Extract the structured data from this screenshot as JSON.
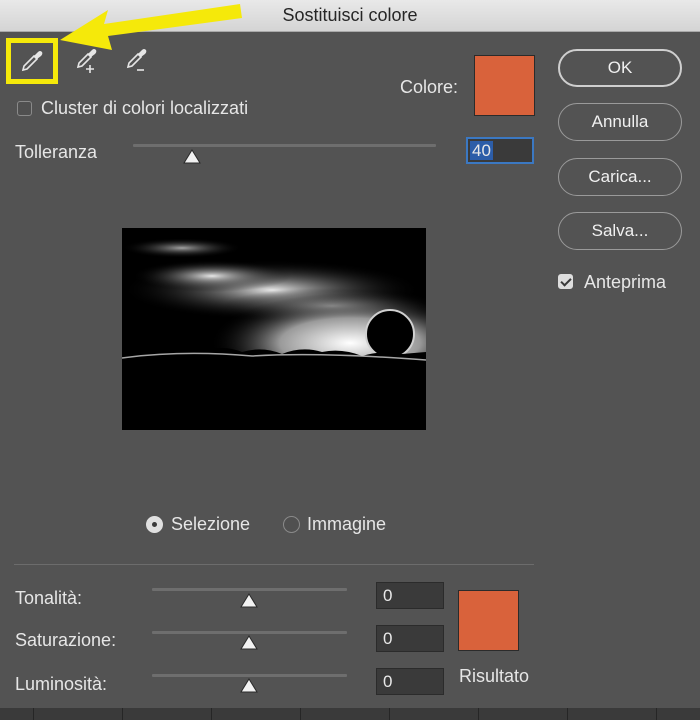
{
  "window": {
    "title": "Sostituisci colore"
  },
  "tools": [
    {
      "name": "eyedropper",
      "selected": true
    },
    {
      "name": "eyedropper-plus"
    },
    {
      "name": "eyedropper-minus"
    }
  ],
  "color": {
    "label": "Colore:",
    "hex": "#d9623b"
  },
  "cluster": {
    "label": "Cluster di colori localizzati",
    "checked": false
  },
  "tolerance": {
    "label": "Tolleranza",
    "value": "40",
    "fraction": 0.2
  },
  "view": {
    "options": [
      {
        "label": "Selezione",
        "selected": true
      },
      {
        "label": "Immagine",
        "selected": false
      }
    ]
  },
  "adjust": {
    "hue": {
      "label": "Tonalità:",
      "value": "0"
    },
    "saturation": {
      "label": "Saturazione:",
      "value": "0"
    },
    "lightness": {
      "label": "Luminosità:",
      "value": "0"
    }
  },
  "result": {
    "label": "Risultato",
    "hex": "#d9623b"
  },
  "buttons": {
    "ok": "OK",
    "cancel": "Annulla",
    "load": "Carica...",
    "save": "Salva..."
  },
  "preview_checkbox": {
    "label": "Anteprima",
    "checked": true
  },
  "colors": {
    "annotation": "#f5e90a",
    "dialog_bg": "#535353"
  }
}
